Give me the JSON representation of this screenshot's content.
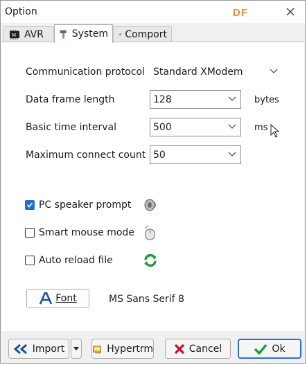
{
  "window": {
    "title": "Option",
    "brand": "DF"
  },
  "tabs": [
    {
      "label": "AVR",
      "icon": "chip-icon"
    },
    {
      "label": "System",
      "icon": "hammer-icon"
    },
    {
      "label": "Comport",
      "icon": "cable-icon"
    }
  ],
  "fields": {
    "protocol": {
      "label": "Communication protocol",
      "value": "Standard XModem"
    },
    "frame": {
      "label": "Data frame length",
      "value": "128",
      "unit": "bytes"
    },
    "interval": {
      "label": "Basic time interval",
      "value": "500",
      "unit": "ms"
    },
    "connect": {
      "label": "Maximum connect count",
      "value": "50"
    }
  },
  "options": {
    "speaker": {
      "label": "PC speaker prompt",
      "checked": true
    },
    "mouse": {
      "label": "Smart mouse mode",
      "checked": false
    },
    "reload": {
      "label": "Auto reload file",
      "checked": false
    }
  },
  "font": {
    "button_label": "Font",
    "current": "MS Sans Serif 8"
  },
  "buttons": {
    "import": "Import",
    "hypertrm": "Hypertrm",
    "cancel": "Cancel",
    "ok": "Ok"
  },
  "colors": {
    "accent": "#2b6fd6",
    "brand": "#f08a3c",
    "checked": "#1f6fd1"
  }
}
